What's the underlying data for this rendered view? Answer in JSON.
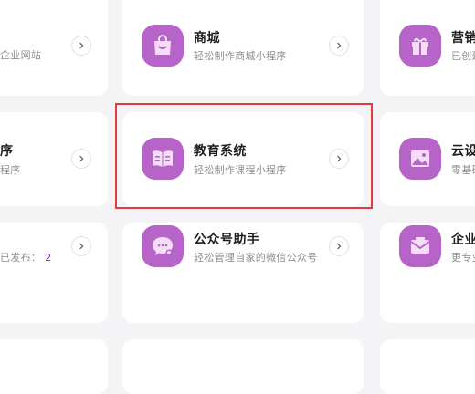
{
  "cards": {
    "website": {
      "subtitle": "企业网站"
    },
    "shop": {
      "title": "商城",
      "subtitle": "轻松制作商城小程序"
    },
    "marketing": {
      "title": "营销",
      "subtitle": "已创建"
    },
    "left_mid": {
      "title": "序",
      "subtitle": "程序"
    },
    "education": {
      "title": "教育系统",
      "subtitle": "轻松制作课程小程序"
    },
    "cloud": {
      "title": "云设",
      "subtitle": "零基础"
    },
    "publish": {
      "subtitle_prefix": "已发布：",
      "count": "2"
    },
    "official_account": {
      "title": "公众号助手",
      "subtitle": "轻松管理自家的微信公众号"
    },
    "enterprise": {
      "title": "企业",
      "subtitle": "更专业"
    }
  },
  "colors": {
    "accent": "#b764c8",
    "highlight": "#e23c3c",
    "count": "#7a2bc0"
  },
  "icons": {
    "shop": "shopping-bag-icon",
    "marketing": "gift-icon",
    "education": "open-book-icon",
    "cloud": "image-icon",
    "official_account": "chat-gear-icon",
    "enterprise": "mail-icon",
    "arrow": "chevron-right-icon"
  }
}
